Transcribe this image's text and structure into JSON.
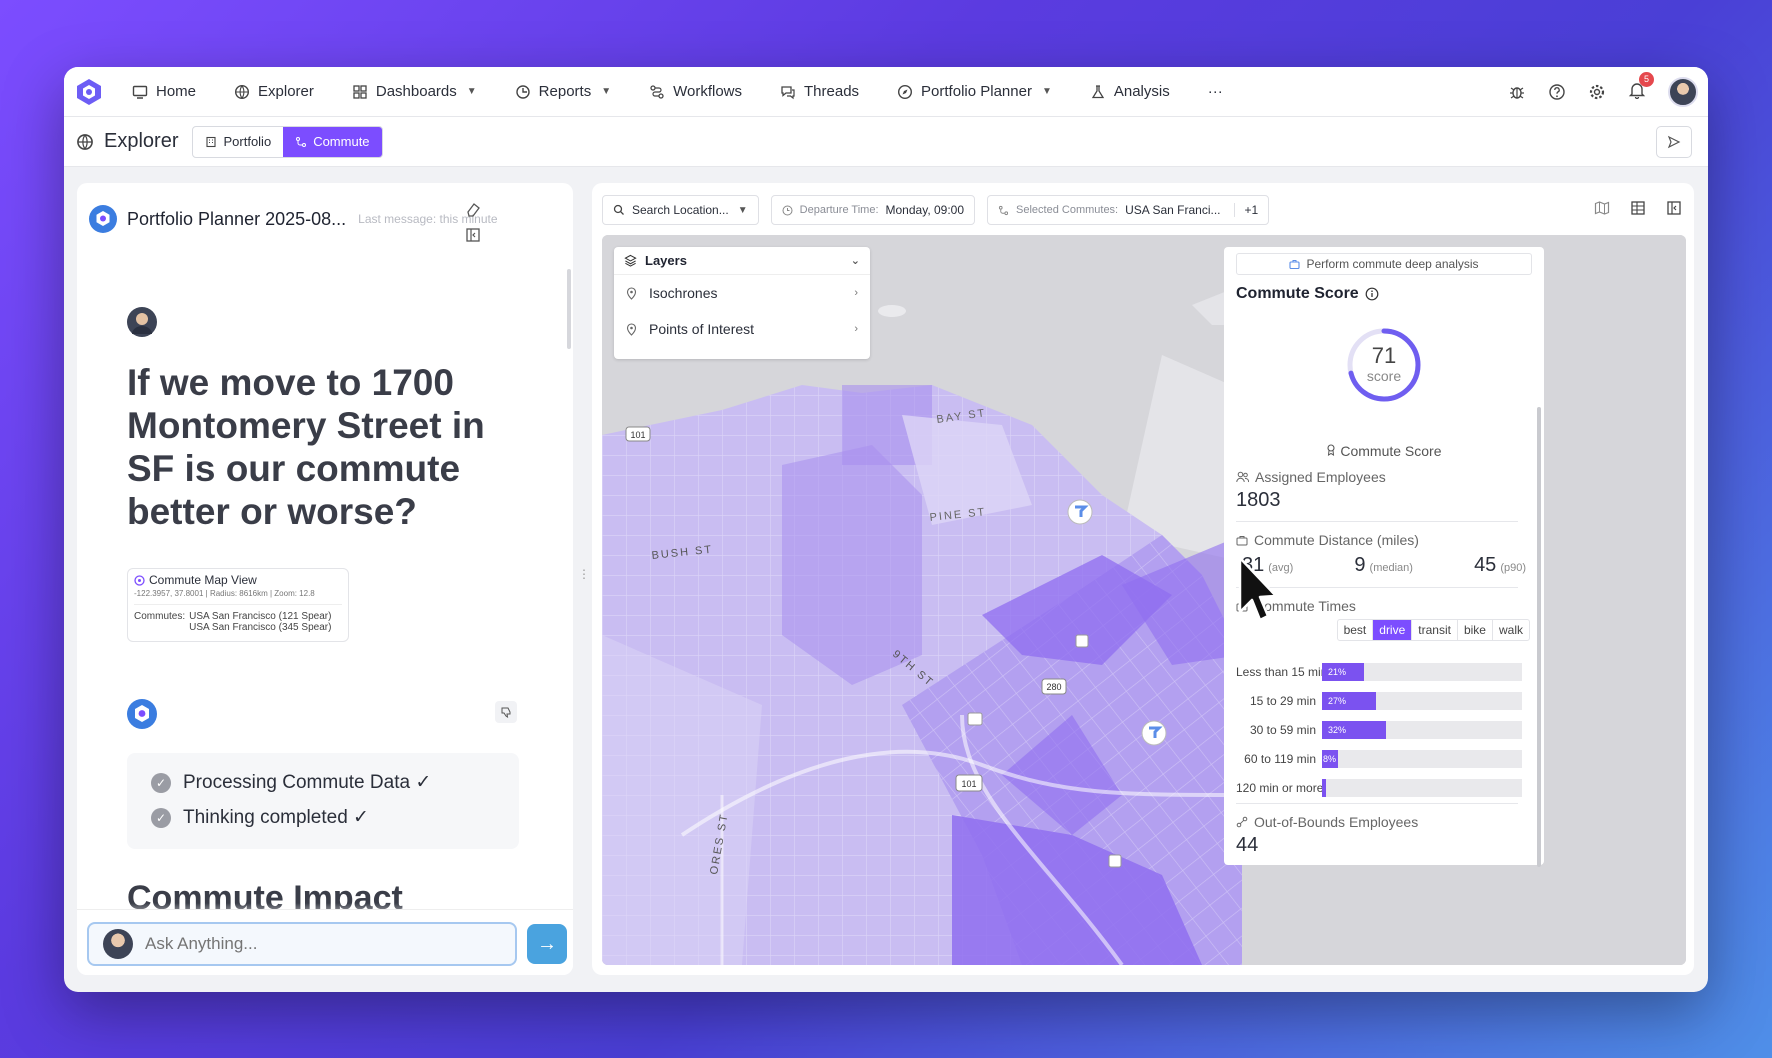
{
  "nav": {
    "items": [
      {
        "label": "Home",
        "icon": "monitor-icon"
      },
      {
        "label": "Explorer",
        "icon": "globe-icon"
      },
      {
        "label": "Dashboards",
        "icon": "grid-icon",
        "dropdown": true
      },
      {
        "label": "Reports",
        "icon": "report-icon",
        "dropdown": true
      },
      {
        "label": "Workflows",
        "icon": "workflow-icon"
      },
      {
        "label": "Threads",
        "icon": "threads-icon"
      },
      {
        "label": "Portfolio Planner",
        "icon": "compass-icon",
        "dropdown": true
      },
      {
        "label": "Analysis",
        "icon": "flask-icon"
      }
    ],
    "more": "···",
    "notification_count": "5"
  },
  "subheader": {
    "title": "Explorer",
    "tabs": [
      {
        "label": "Portfolio",
        "active": false
      },
      {
        "label": "Commute",
        "active": true
      }
    ]
  },
  "chat": {
    "title": "Portfolio Planner 2025-08...",
    "subtitle": "Last message: this minute",
    "question": "If we move to 1700 Montomery Street in SF is our commute better or worse?",
    "card": {
      "title": "Commute Map View",
      "coords": "-122.3957, 37.8001",
      "radius": "Radius: 8616km",
      "zoom": "Zoom: 12.8",
      "commutes_label": "Commutes:",
      "commute_1": "USA San Francisco (121 Spear)",
      "commute_2": "USA San Francisco (345 Spear)"
    },
    "steps": [
      "Processing Commute Data ✓",
      "Thinking completed ✓"
    ],
    "heading": "Commute Impact",
    "input_placeholder": "Ask Anything..."
  },
  "toolbar": {
    "search": "Search Location...",
    "departure_label": "Departure Time:",
    "departure_value": "Monday, 09:00",
    "selected_label": "Selected Commutes:",
    "selected_value": "USA San Franci...",
    "selected_extra": "+1"
  },
  "layers": {
    "title": "Layers",
    "items": [
      "Isochrones",
      "Points of Interest"
    ]
  },
  "map_labels": {
    "bay": "BAY ST",
    "pine": "PINE ST",
    "bush": "BUSH ST",
    "ninth": "9TH ST",
    "flores": "ORES ST",
    "h101a": "101",
    "h101b": "101",
    "h280": "280"
  },
  "score": {
    "deep_analysis": "Perform commute deep analysis",
    "title": "Commute Score",
    "value": 71,
    "value_label": "score",
    "score_caption": "Commute Score",
    "assigned_label": "Assigned Employees",
    "assigned_value": "1803",
    "distance_label": "Commute Distance (miles)",
    "dist_avg": "31",
    "dist_avg_label": "(avg)",
    "dist_median": "9",
    "dist_median_label": "(median)",
    "dist_p90": "45",
    "dist_p90_label": "(p90)",
    "times_label": "Commute Times",
    "modes": [
      "best",
      "drive",
      "transit",
      "bike",
      "walk"
    ],
    "active_mode": "drive",
    "bars": [
      {
        "label": "Less than 15 min",
        "pct": 21,
        "text": "21%"
      },
      {
        "label": "15 to 29 min",
        "pct": 27,
        "text": "27%"
      },
      {
        "label": "30 to 59 min",
        "pct": 32,
        "text": "32%"
      },
      {
        "label": "60 to 119 min",
        "pct": 8,
        "text": "8%"
      },
      {
        "label": "120 min or more",
        "pct": 2,
        "text": ""
      }
    ],
    "oob_label": "Out-of-Bounds Employees",
    "oob_value": "44"
  },
  "colors": {
    "accent": "#7c4dff",
    "iso_light": "#c9bdf2",
    "iso_mid": "#a88fee",
    "iso_dark": "#8f6ef0"
  }
}
